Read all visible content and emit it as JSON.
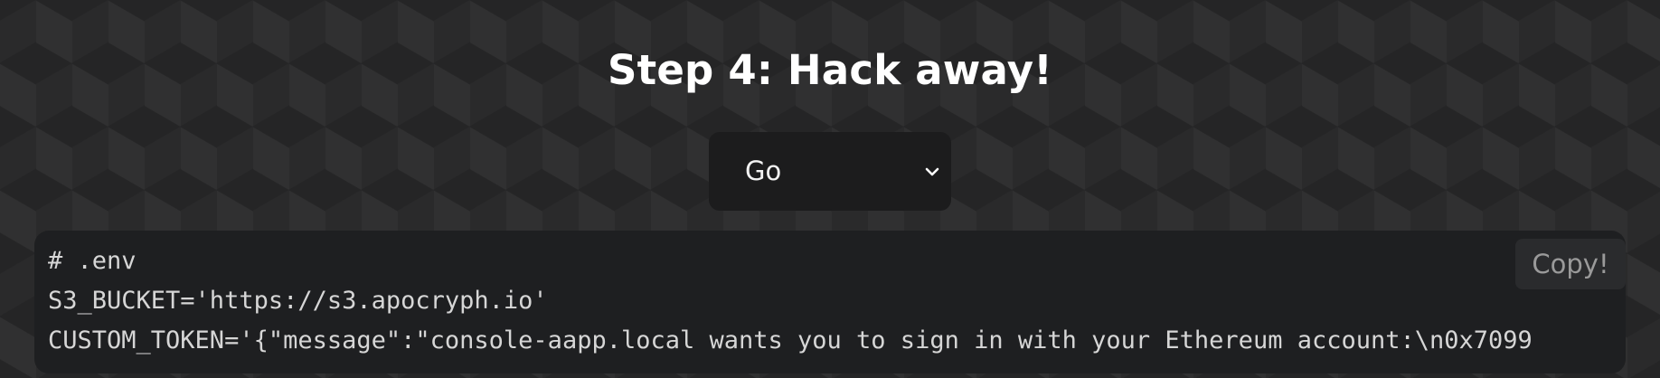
{
  "header": {
    "title": "Step 4: Hack away!"
  },
  "selector": {
    "selected": "Go",
    "icon": "chevron-down-icon"
  },
  "code": {
    "lines": [
      "# .env",
      "S3_BUCKET='https://s3.apocryph.io'",
      "CUSTOM_TOKEN='{\"message\":\"console-aapp.local wants you to sign in with your Ethereum account:\\n0x7099"
    ],
    "copy_label": "Copy!"
  },
  "colors": {
    "background": "#2a2a2b",
    "panel": "#1e1f21",
    "select": "#1c1c1d",
    "text": "#ffffff",
    "code_text": "#d6d6d6",
    "copy_text": "#9a9a9a"
  }
}
